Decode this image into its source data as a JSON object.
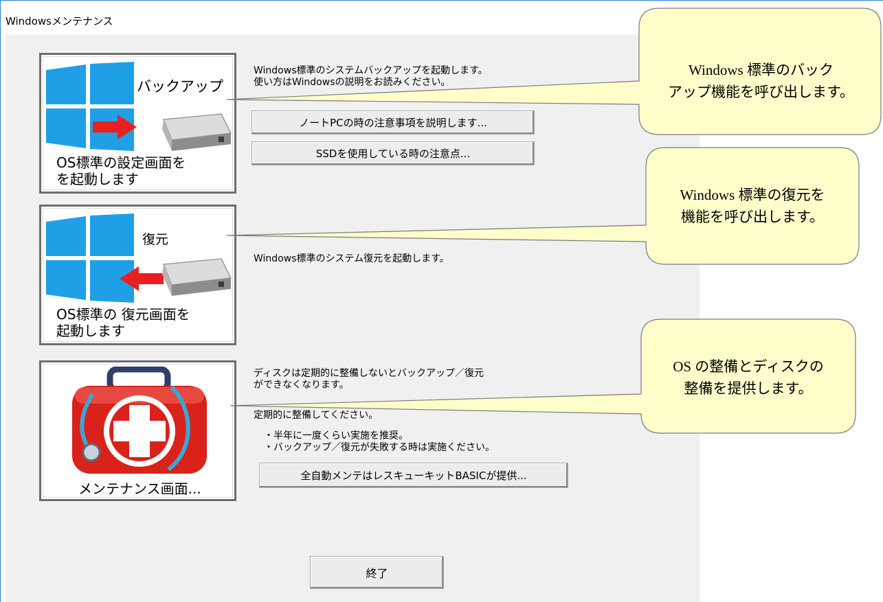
{
  "window": {
    "title": "Windowsメンテナンス"
  },
  "backup": {
    "title": "バックアップ",
    "caption": "OS標準の設定画面を\nを起動します",
    "description": "Windows標準のシステムバックアップを起動します。\n使い方はWindowsの説明をお読みください。",
    "buttons": [
      "ノートPCの時の注意事項を説明します...",
      "SSDを使用している時の注意点..."
    ]
  },
  "restore": {
    "title": "復元",
    "caption": "OS標準の 復元画面を\n起動します",
    "description": "Windows標準のシステム復元を起動します。"
  },
  "maintenance": {
    "caption": "メンテナンス画面...",
    "description": "ディスクは定期的に整備しないとバックアップ／復元\nができなくなります。",
    "description2": "定期的に整備してください。",
    "bullets": "・半年に一度くらい実施を推奨。\n・バックアップ／復元が失敗する時は実施ください。",
    "button": "全自動メンテはレスキューキットBASICが提供..."
  },
  "exit_button": "終了",
  "callouts": [
    "Windows 標準のバック\nアップ機能を呼び出します。",
    "Windows 標準の復元を\n機能を呼び出します。",
    "OS の整備とディスクの\n整備を提供します。"
  ],
  "colors": {
    "callout_fill": "#ffffcc",
    "windows_logo": "#1fa0e6",
    "arrow": "#e8201f",
    "case_red": "#d8221a"
  }
}
